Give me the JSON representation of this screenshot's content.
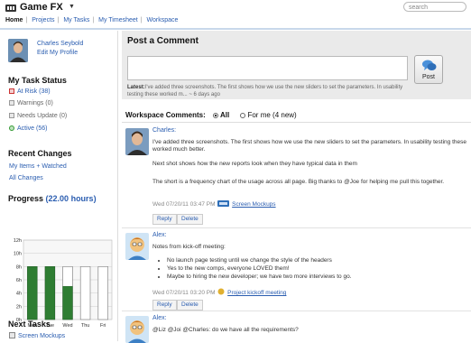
{
  "app": {
    "title": "Game FX"
  },
  "nav": [
    "Home",
    "Projects",
    "My Tasks",
    "My Timesheet",
    "Workspace"
  ],
  "search": {
    "placeholder": "search"
  },
  "profile": {
    "name": "Charles Seybold",
    "edit_link": "Edit My Profile"
  },
  "task_status": {
    "title": "My Task Status",
    "items": [
      {
        "label": "At Risk (38)",
        "color": "#cc3333"
      },
      {
        "label": "Warnings (0)"
      },
      {
        "label": "Needs Update (0)"
      },
      {
        "label": "Active (56)",
        "color": "#339933"
      }
    ]
  },
  "recent_changes": {
    "title": "Recent Changes",
    "links": [
      "My Items + Watched",
      "All Changes"
    ]
  },
  "progress": {
    "title": "Progress",
    "hours": "(22.00 hours)"
  },
  "chart_data": {
    "type": "bar",
    "categories": [
      "Mon",
      "Tue",
      "Wed",
      "Thu",
      "Fri"
    ],
    "series": [
      {
        "values": [
          8,
          8,
          5,
          0,
          0
        ],
        "color": "#2e7d32"
      },
      {
        "values": [
          8,
          8,
          8,
          8,
          8
        ],
        "color": "#ffffff"
      }
    ],
    "yticks": [
      "12h",
      "10h",
      "8h",
      "6h",
      "4h",
      "2h",
      "0h"
    ],
    "ylim": [
      0,
      12
    ]
  },
  "next_tasks": {
    "title": "Next Tasks",
    "items": [
      "Screen Mockups"
    ]
  },
  "post": {
    "title": "Post a Comment",
    "button": "Post",
    "latest_label": "Latest:",
    "latest_text": "I've added three screenshots.  The first shows how we use the new sliders to set the parameters. In usability testing these worked m...",
    "latest_age": "~ 6 days ago"
  },
  "workspace_comments": {
    "label": "Workspace Comments:",
    "all": "All",
    "for_me": "For me (4 new)"
  },
  "comments": [
    {
      "author": "Charles:",
      "paragraphs": [
        "I've added three screenshots.  The first shows how we use the new sliders to set the parameters.  In usability testing these worked much better.",
        "Next shot shows how the new reports look when they have typical data in them",
        "The short is a frequency chart of the usage across all page. Big thanks to @Joe for helping me pull this together."
      ],
      "meta": "Wed 07/20/11 03:47 PM",
      "attachment": "Screen Mockups",
      "reply": "Reply",
      "delete": "Delete"
    },
    {
      "author": "Alex:",
      "intro": "Notes from kick-off meeting:",
      "bullets": [
        "No launch page testing until we change the style of the headers",
        "Yes to the new comps, everyone LOVED them!",
        "Maybe to hiring the new developer; we have two more interviews to go."
      ],
      "meta": "Wed 07/20/11 03:20 PM",
      "attachment": "Project kickoff meeting",
      "reply": "Reply",
      "delete": "Delete"
    },
    {
      "author": "Alex:",
      "text": "@Liz @Joi @Charles: do we have all the requirements?"
    }
  ]
}
